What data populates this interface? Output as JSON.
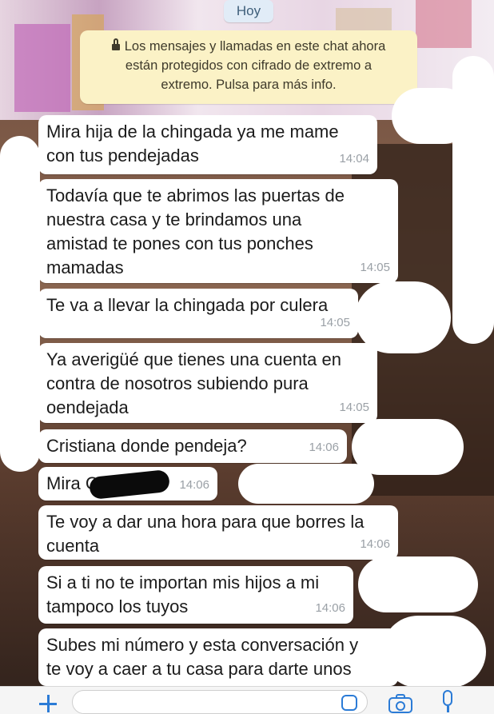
{
  "date_chip": "Hoy",
  "encryption_notice": "Los mensajes y llamadas en este chat ahora\nestán protegidos con cifrado de extremo a\nextremo. Pulsa para más info.",
  "messages": [
    {
      "text": "Mira hija de la chingada ya me mame\ncon tus pendejadas",
      "time": "14:04"
    },
    {
      "text": "Todavía que te abrimos las puertas de\nnuestra casa y te brindamos una\namistad te pones con tus ponches\nmamadas",
      "time": "14:05"
    },
    {
      "text": "Te va a llevar la chingada por culera",
      "time": "14:05"
    },
    {
      "text": "Ya averigüé que tienes una cuenta en\ncontra de nosotros subiendo pura\noendejada",
      "time": "14:05"
    },
    {
      "text": "Cristiana donde pendeja?",
      "time": "14:06"
    },
    {
      "text": "Mira C",
      "time": "14:06"
    },
    {
      "text": "Te voy a dar una hora para que borres la\ncuenta",
      "time": "14:06"
    },
    {
      "text": "Si a ti no te importan mis hijos a mi\ntampoco los tuyos",
      "time": "14:06"
    },
    {
      "text": "Subes mi número y esta conversación y\nte voy a caer a tu casa para darte unos",
      "time": ""
    }
  ],
  "icons": {
    "attach": "plus-icon",
    "sticker": "sticker-icon",
    "camera": "camera-icon",
    "mic": "mic-icon",
    "lock": "lock-icon"
  },
  "colors": {
    "accent": "#2b7bd6",
    "notice_bg": "#fbf2c6",
    "date_chip_bg": "#e1ecf7",
    "bubble_bg": "#ffffff"
  }
}
